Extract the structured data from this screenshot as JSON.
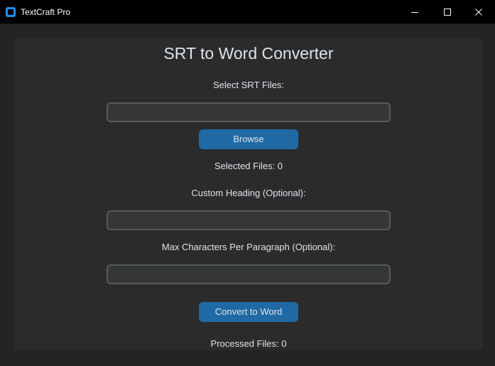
{
  "window": {
    "title": "TextCraft Pro",
    "app_icon": "app-icon",
    "controls": [
      "minimize-icon",
      "maximize-icon",
      "close-icon"
    ]
  },
  "colors": {
    "accent": "#1f6aa5",
    "panel": "#2b2b2b",
    "background": "#242424",
    "field": "#343638",
    "text": "#dce4ee"
  },
  "main": {
    "heading": "SRT to Word Converter",
    "select_label": "Select SRT Files:",
    "srt_files_value": "",
    "browse_label": "Browse",
    "selected_files": "Selected Files: 0",
    "custom_heading_label": "Custom Heading (Optional):",
    "custom_heading_value": "",
    "max_chars_label": "Max Characters Per Paragraph (Optional):",
    "max_chars_value": "",
    "convert_label": "Convert to Word",
    "processed_files": "Processed Files: 0"
  }
}
